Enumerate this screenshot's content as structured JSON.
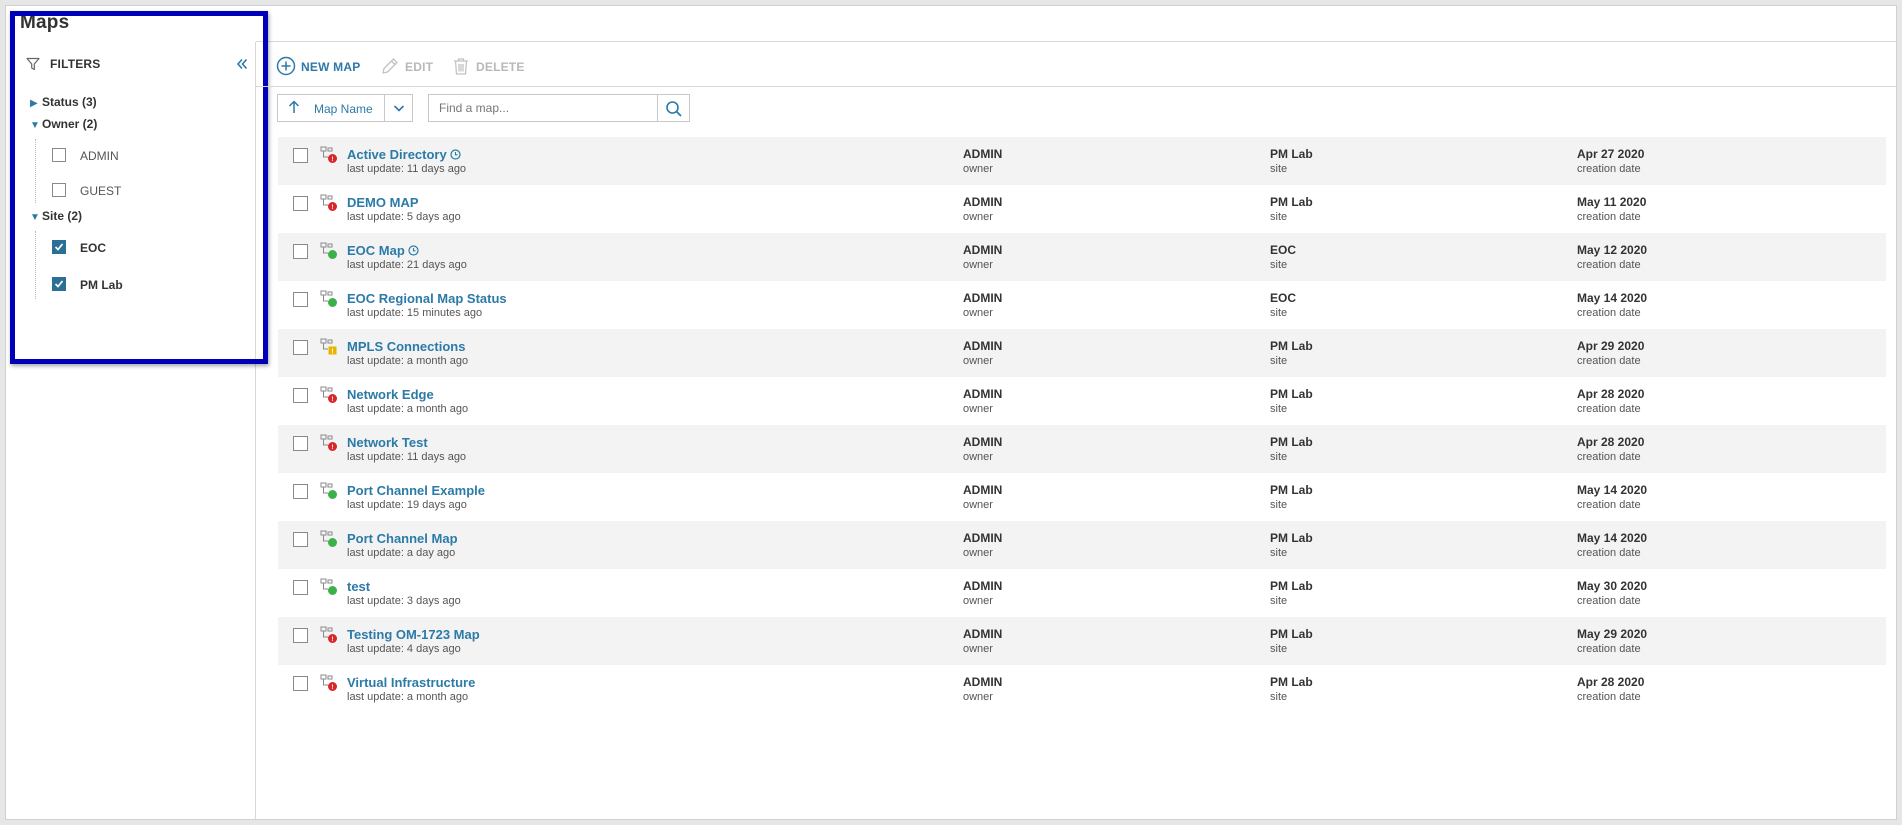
{
  "page": {
    "title": "Maps"
  },
  "colors": {
    "accent": "#2b7aa8",
    "checkbox_checked": "#2b6f96",
    "status_down": "#d9262b",
    "status_up": "#3bb149",
    "status_warning": "#e9b400",
    "highlight": "#0000b8"
  },
  "filters": {
    "title": "FILTERS",
    "collapse_icon": "double-chevron-left-icon",
    "groups": [
      {
        "label": "Status (3)",
        "expanded": false,
        "items": []
      },
      {
        "label": "Owner (2)",
        "expanded": true,
        "items": [
          {
            "label": "ADMIN",
            "checked": false
          },
          {
            "label": "GUEST",
            "checked": false
          }
        ]
      },
      {
        "label": "Site (2)",
        "expanded": true,
        "items": [
          {
            "label": "EOC",
            "checked": true
          },
          {
            "label": "PM Lab",
            "checked": true
          }
        ]
      }
    ]
  },
  "toolbar": {
    "new_map": "NEW MAP",
    "edit": "EDIT",
    "delete": "DELETE"
  },
  "sort": {
    "label": "Map Name",
    "direction": "ascending"
  },
  "search": {
    "placeholder": "Find a map...",
    "value": ""
  },
  "column_captions": {
    "owner": "owner",
    "site": "site",
    "date": "creation date"
  },
  "maps": [
    {
      "name": "Active Directory",
      "scheduled": true,
      "status": "down",
      "last_update": "last update: 11 days ago",
      "owner": "ADMIN",
      "site": "PM Lab",
      "created": "Apr 27 2020"
    },
    {
      "name": "DEMO MAP",
      "scheduled": false,
      "status": "down",
      "last_update": "last update: 5 days ago",
      "owner": "ADMIN",
      "site": "PM Lab",
      "created": "May 11 2020"
    },
    {
      "name": "EOC Map",
      "scheduled": true,
      "status": "up",
      "last_update": "last update: 21 days ago",
      "owner": "ADMIN",
      "site": "EOC",
      "created": "May 12 2020"
    },
    {
      "name": "EOC Regional Map Status",
      "scheduled": false,
      "status": "up",
      "last_update": "last update: 15 minutes ago",
      "owner": "ADMIN",
      "site": "EOC",
      "created": "May 14 2020"
    },
    {
      "name": "MPLS Connections",
      "scheduled": false,
      "status": "warning",
      "last_update": "last update: a month ago",
      "owner": "ADMIN",
      "site": "PM Lab",
      "created": "Apr 29 2020"
    },
    {
      "name": "Network Edge",
      "scheduled": false,
      "status": "down",
      "last_update": "last update: a month ago",
      "owner": "ADMIN",
      "site": "PM Lab",
      "created": "Apr 28 2020"
    },
    {
      "name": "Network Test",
      "scheduled": false,
      "status": "down",
      "last_update": "last update: 11 days ago",
      "owner": "ADMIN",
      "site": "PM Lab",
      "created": "Apr 28 2020"
    },
    {
      "name": "Port Channel Example",
      "scheduled": false,
      "status": "up",
      "last_update": "last update: 19 days ago",
      "owner": "ADMIN",
      "site": "PM Lab",
      "created": "May 14 2020"
    },
    {
      "name": "Port Channel Map",
      "scheduled": false,
      "status": "up",
      "last_update": "last update: a day ago",
      "owner": "ADMIN",
      "site": "PM Lab",
      "created": "May 14 2020"
    },
    {
      "name": "test",
      "scheduled": false,
      "status": "up",
      "last_update": "last update: 3 days ago",
      "owner": "ADMIN",
      "site": "PM Lab",
      "created": "May 30 2020"
    },
    {
      "name": "Testing OM-1723 Map",
      "scheduled": false,
      "status": "down",
      "last_update": "last update: 4 days ago",
      "owner": "ADMIN",
      "site": "PM Lab",
      "created": "May 29 2020"
    },
    {
      "name": "Virtual Infrastructure",
      "scheduled": false,
      "status": "down",
      "last_update": "last update: a month ago",
      "owner": "ADMIN",
      "site": "PM Lab",
      "created": "Apr 28 2020"
    }
  ]
}
